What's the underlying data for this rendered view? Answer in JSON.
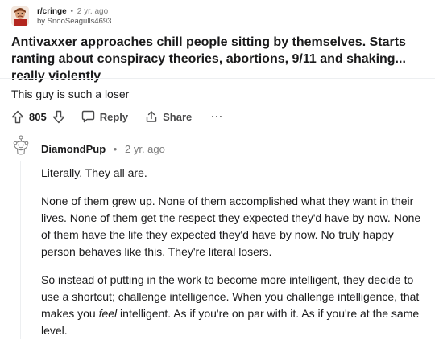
{
  "post": {
    "subreddit": "r/cringe",
    "separator": "•",
    "age": "2 yr. ago",
    "author_line": "by SnooSeagulls4693",
    "title": "Antivaxxer approaches chill people sitting by themselves. Starts ranting about conspiracy theories, abortions, 9/11 and shaking... really violently",
    "avatar_icon": "subreddit-avatar-icon"
  },
  "comment": {
    "text": "This guy is such a loser",
    "votes": "805",
    "reply_label": "Reply",
    "share_label": "Share",
    "more_label": "···"
  },
  "reply": {
    "username": "DiamondPup",
    "separator": "•",
    "age": "2 yr. ago",
    "avatar_icon": "snoo-avatar-icon",
    "paragraph1": "Literally. They all are.",
    "paragraph2": "None of them grew up. None of them accomplished what they want in their lives. None of them get the respect they expected they'd have by now. None of them have the life they expected they'd have by now. No truly happy person behaves like this. They're literal losers.",
    "paragraph3_before": "So instead of putting in the work to become more intelligent, they decide to use a shortcut; challenge intelligence. When you challenge intelligence, that makes you ",
    "paragraph3_em": "feel",
    "paragraph3_after": " intelligent. As if you're on par with it. As if you're at the same level."
  },
  "colors": {
    "text": "#1a1a1b",
    "meta": "#7c7c7c",
    "action": "#4a4a4b",
    "divider": "#edeff1"
  }
}
